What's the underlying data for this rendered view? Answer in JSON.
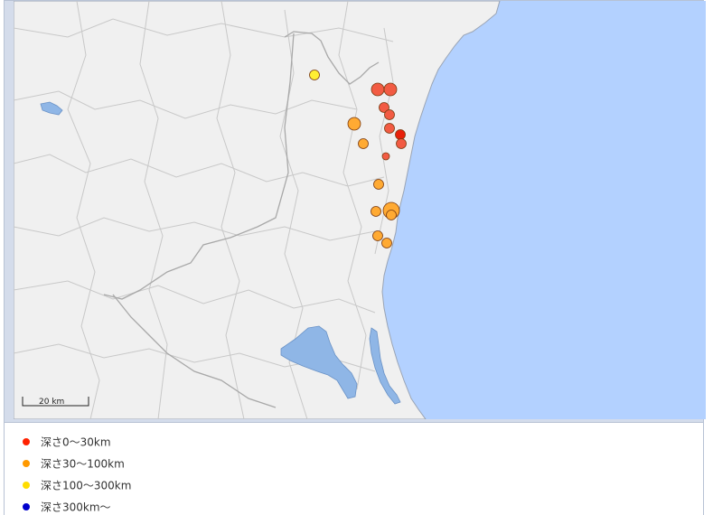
{
  "scale_bar": {
    "label": "20 km"
  },
  "legend": {
    "items": [
      {
        "label": "深さ0～30km",
        "color": "#ff2200"
      },
      {
        "label": "深さ30～100km",
        "color": "#ff9900"
      },
      {
        "label": "深さ100～300km",
        "color": "#ffdd00"
      },
      {
        "label": "深さ300km～",
        "color": "#0000cc"
      }
    ]
  },
  "colors": {
    "sea": "#b3d1ff",
    "land": "#f0f0f0",
    "border": "#c8c8c8",
    "lake": "#8fb6e6",
    "shallow": "#f25b43",
    "mid": "#ffaa33",
    "deep": "#ffee33"
  },
  "epicenters": [
    {
      "depth_class": "100-300",
      "size": "small"
    },
    {
      "depth_class": "0-30",
      "size": "medium"
    },
    {
      "depth_class": "0-30",
      "size": "medium"
    },
    {
      "depth_class": "30-100",
      "size": "medium"
    },
    {
      "depth_class": "0-30",
      "size": "small"
    },
    {
      "depth_class": "0-30",
      "size": "small"
    },
    {
      "depth_class": "0-30",
      "size": "small"
    },
    {
      "depth_class": "0-30",
      "size": "small"
    },
    {
      "depth_class": "0-30",
      "size": "small"
    },
    {
      "depth_class": "0-30",
      "size": "tiny"
    },
    {
      "depth_class": "30-100",
      "size": "small"
    },
    {
      "depth_class": "30-100",
      "size": "small"
    },
    {
      "depth_class": "30-100",
      "size": "small"
    },
    {
      "depth_class": "30-100",
      "size": "medium"
    },
    {
      "depth_class": "30-100",
      "size": "small"
    },
    {
      "depth_class": "30-100",
      "size": "small"
    },
    {
      "depth_class": "30-100",
      "size": "small"
    }
  ]
}
